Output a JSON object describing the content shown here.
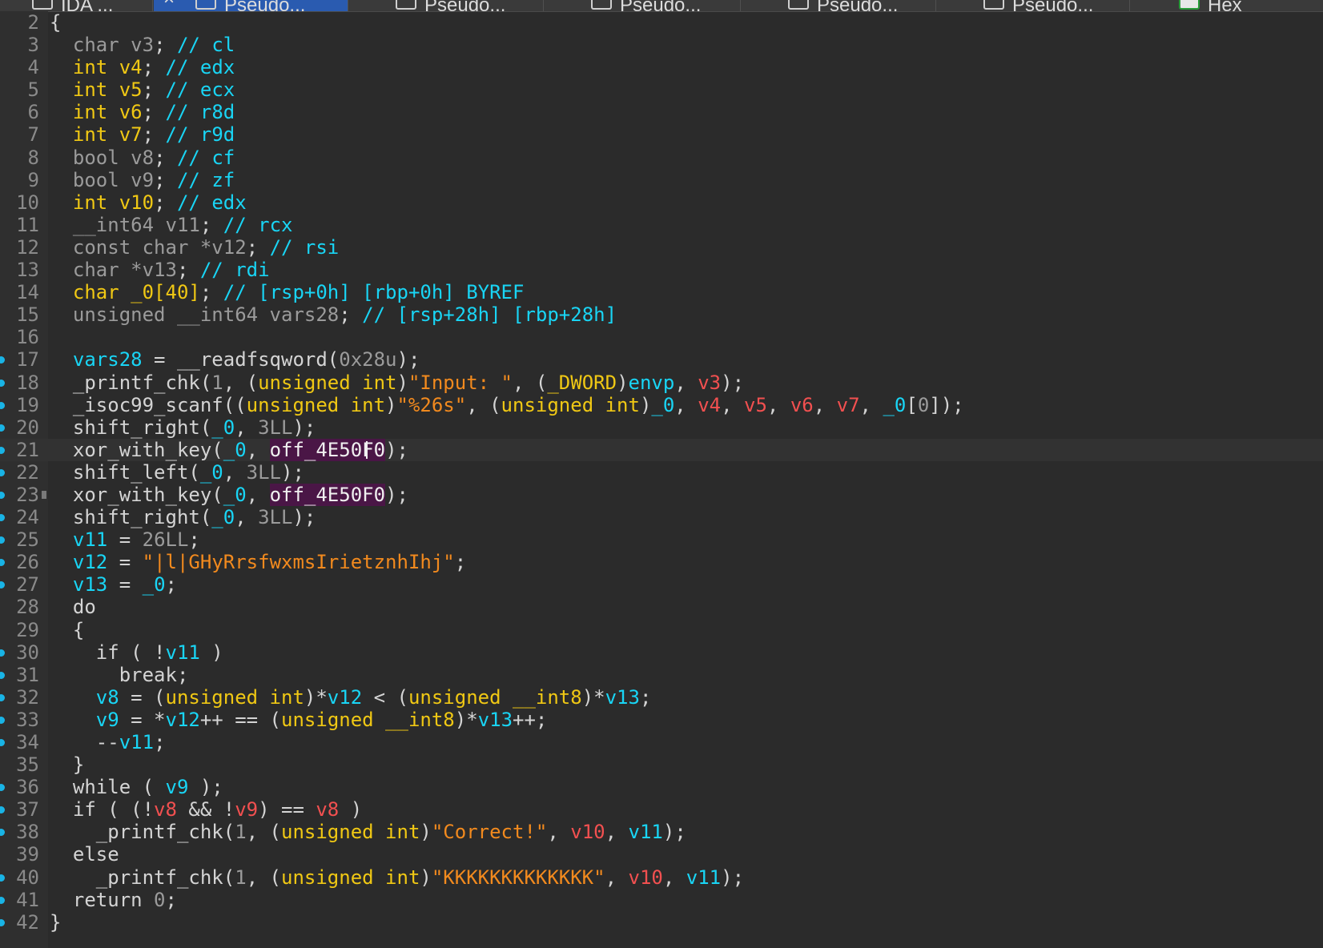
{
  "tabs": [
    {
      "label": "IDA ...",
      "icon": "ida-view-icon"
    },
    {
      "label": "Pseudo...",
      "icon": "pseudocode-icon",
      "active": true,
      "close_glyph": "×"
    },
    {
      "label": "Pseudo...",
      "icon": "pseudocode-icon"
    },
    {
      "label": "Pseudo...",
      "icon": "pseudocode-icon"
    },
    {
      "label": "Pseudo...",
      "icon": "pseudocode-icon"
    },
    {
      "label": "Pseudo...",
      "icon": "pseudocode-icon"
    },
    {
      "label": "Hex",
      "icon": "hex-view-icon"
    }
  ],
  "code_lines": [
    {
      "n": "2",
      "bp": false,
      "segs": [
        [
          "pl",
          "{"
        ]
      ]
    },
    {
      "n": "3",
      "bp": false,
      "segs": [
        [
          "pl",
          "  "
        ],
        [
          "g",
          "char v3"
        ],
        [
          "pl",
          "; "
        ],
        [
          "c",
          "// cl"
        ]
      ]
    },
    {
      "n": "4",
      "bp": false,
      "segs": [
        [
          "pl",
          "  "
        ],
        [
          "k",
          "int v4"
        ],
        [
          "pl",
          "; "
        ],
        [
          "c",
          "// edx"
        ]
      ]
    },
    {
      "n": "5",
      "bp": false,
      "segs": [
        [
          "pl",
          "  "
        ],
        [
          "k",
          "int v5"
        ],
        [
          "pl",
          "; "
        ],
        [
          "c",
          "// ecx"
        ]
      ]
    },
    {
      "n": "6",
      "bp": false,
      "segs": [
        [
          "pl",
          "  "
        ],
        [
          "k",
          "int v6"
        ],
        [
          "pl",
          "; "
        ],
        [
          "c",
          "// r8d"
        ]
      ]
    },
    {
      "n": "7",
      "bp": false,
      "segs": [
        [
          "pl",
          "  "
        ],
        [
          "k",
          "int v7"
        ],
        [
          "pl",
          "; "
        ],
        [
          "c",
          "// r9d"
        ]
      ]
    },
    {
      "n": "8",
      "bp": false,
      "segs": [
        [
          "pl",
          "  "
        ],
        [
          "g",
          "bool v8"
        ],
        [
          "pl",
          "; "
        ],
        [
          "c",
          "// cf"
        ]
      ]
    },
    {
      "n": "9",
      "bp": false,
      "segs": [
        [
          "pl",
          "  "
        ],
        [
          "g",
          "bool v9"
        ],
        [
          "pl",
          "; "
        ],
        [
          "c",
          "// zf"
        ]
      ]
    },
    {
      "n": "10",
      "bp": false,
      "segs": [
        [
          "pl",
          "  "
        ],
        [
          "k",
          "int v10"
        ],
        [
          "pl",
          "; "
        ],
        [
          "c",
          "// edx"
        ]
      ]
    },
    {
      "n": "11",
      "bp": false,
      "segs": [
        [
          "pl",
          "  "
        ],
        [
          "g",
          "__int64 v11"
        ],
        [
          "pl",
          "; "
        ],
        [
          "c",
          "// rcx"
        ]
      ]
    },
    {
      "n": "12",
      "bp": false,
      "segs": [
        [
          "pl",
          "  "
        ],
        [
          "g",
          "const char *v12"
        ],
        [
          "pl",
          "; "
        ],
        [
          "c",
          "// rsi"
        ]
      ]
    },
    {
      "n": "13",
      "bp": false,
      "segs": [
        [
          "pl",
          "  "
        ],
        [
          "g",
          "char *v13"
        ],
        [
          "pl",
          "; "
        ],
        [
          "c",
          "// rdi"
        ]
      ]
    },
    {
      "n": "14",
      "bp": false,
      "segs": [
        [
          "pl",
          "  "
        ],
        [
          "k",
          "char _0[40]"
        ],
        [
          "pl",
          "; "
        ],
        [
          "c",
          "// [rsp+0h] [rbp+0h] BYREF"
        ]
      ]
    },
    {
      "n": "15",
      "bp": false,
      "segs": [
        [
          "pl",
          "  "
        ],
        [
          "g",
          "unsigned __int64 vars28"
        ],
        [
          "pl",
          "; "
        ],
        [
          "c",
          "// [rsp+28h] [rbp+28h]"
        ]
      ]
    },
    {
      "n": "16",
      "bp": false,
      "segs": []
    },
    {
      "n": "17",
      "bp": true,
      "segs": [
        [
          "pl",
          "  "
        ],
        [
          "v",
          "vars28"
        ],
        [
          "pl",
          " = __readfsqword("
        ],
        [
          "g",
          "0x28u"
        ],
        [
          "pl",
          ");"
        ]
      ]
    },
    {
      "n": "18",
      "bp": true,
      "segs": [
        [
          "pl",
          "  _printf_chk("
        ],
        [
          "g",
          "1"
        ],
        [
          "pl",
          ", ("
        ],
        [
          "k",
          "unsigned int"
        ],
        [
          "pl",
          ")"
        ],
        [
          "s",
          "\"Input: \""
        ],
        [
          "pl",
          ", ("
        ],
        [
          "k",
          "_DWORD"
        ],
        [
          "pl",
          ")"
        ],
        [
          "v",
          "envp"
        ],
        [
          "pl",
          ", "
        ],
        [
          "r",
          "v3"
        ],
        [
          "pl",
          ");"
        ]
      ]
    },
    {
      "n": "19",
      "bp": true,
      "segs": [
        [
          "pl",
          "  _isoc99_scanf(("
        ],
        [
          "k",
          "unsigned int"
        ],
        [
          "pl",
          ")"
        ],
        [
          "s",
          "\"%26s\""
        ],
        [
          "pl",
          ", ("
        ],
        [
          "k",
          "unsigned int"
        ],
        [
          "pl",
          ")"
        ],
        [
          "v",
          "_0"
        ],
        [
          "pl",
          ", "
        ],
        [
          "r",
          "v4"
        ],
        [
          "pl",
          ", "
        ],
        [
          "r",
          "v5"
        ],
        [
          "pl",
          ", "
        ],
        [
          "r",
          "v6"
        ],
        [
          "pl",
          ", "
        ],
        [
          "r",
          "v7"
        ],
        [
          "pl",
          ", "
        ],
        [
          "v",
          "_0"
        ],
        [
          "pl",
          "["
        ],
        [
          "g",
          "0"
        ],
        [
          "pl",
          "]);"
        ]
      ]
    },
    {
      "n": "20",
      "bp": true,
      "segs": [
        [
          "pl",
          "  shift_right("
        ],
        [
          "v",
          "_0"
        ],
        [
          "pl",
          ", "
        ],
        [
          "g",
          "3LL"
        ],
        [
          "pl",
          ");"
        ]
      ]
    },
    {
      "n": "21",
      "bp": true,
      "cur": true,
      "segs": [
        [
          "pl",
          "  xor_with_key("
        ],
        [
          "v",
          "_0"
        ],
        [
          "pl",
          ", "
        ],
        [
          "hl",
          "off_4E50F0"
        ],
        [
          "pl",
          ");"
        ]
      ]
    },
    {
      "n": "22",
      "bp": true,
      "segs": [
        [
          "pl",
          "  shift_left("
        ],
        [
          "v",
          "_0"
        ],
        [
          "pl",
          ", "
        ],
        [
          "g",
          "3LL"
        ],
        [
          "pl",
          ");"
        ]
      ]
    },
    {
      "n": "23",
      "bp": true,
      "mark": true,
      "segs": [
        [
          "pl",
          "  xor_with_key("
        ],
        [
          "v",
          "_0"
        ],
        [
          "pl",
          ", "
        ],
        [
          "hl",
          "off_4E50F0"
        ],
        [
          "pl",
          ");"
        ]
      ]
    },
    {
      "n": "24",
      "bp": true,
      "segs": [
        [
          "pl",
          "  shift_right("
        ],
        [
          "v",
          "_0"
        ],
        [
          "pl",
          ", "
        ],
        [
          "g",
          "3LL"
        ],
        [
          "pl",
          ");"
        ]
      ]
    },
    {
      "n": "25",
      "bp": true,
      "segs": [
        [
          "pl",
          "  "
        ],
        [
          "v",
          "v11"
        ],
        [
          "pl",
          " = "
        ],
        [
          "g",
          "26LL"
        ],
        [
          "pl",
          ";"
        ]
      ]
    },
    {
      "n": "26",
      "bp": true,
      "segs": [
        [
          "pl",
          "  "
        ],
        [
          "v",
          "v12"
        ],
        [
          "pl",
          " = "
        ],
        [
          "s",
          "\"|l|GHyRrsfwxmsIrietznhIhj\""
        ],
        [
          "pl",
          ";"
        ]
      ]
    },
    {
      "n": "27",
      "bp": true,
      "segs": [
        [
          "pl",
          "  "
        ],
        [
          "v",
          "v13"
        ],
        [
          "pl",
          " = "
        ],
        [
          "v",
          "_0"
        ],
        [
          "pl",
          ";"
        ]
      ]
    },
    {
      "n": "28",
      "bp": false,
      "segs": [
        [
          "pl",
          "  do"
        ]
      ]
    },
    {
      "n": "29",
      "bp": false,
      "segs": [
        [
          "pl",
          "  {"
        ]
      ]
    },
    {
      "n": "30",
      "bp": true,
      "segs": [
        [
          "pl",
          "    if ( !"
        ],
        [
          "v",
          "v11"
        ],
        [
          "pl",
          " )"
        ]
      ]
    },
    {
      "n": "31",
      "bp": true,
      "segs": [
        [
          "pl",
          "      break;"
        ]
      ]
    },
    {
      "n": "32",
      "bp": true,
      "segs": [
        [
          "pl",
          "    "
        ],
        [
          "v",
          "v8"
        ],
        [
          "pl",
          " = ("
        ],
        [
          "k",
          "unsigned int"
        ],
        [
          "pl",
          ")*"
        ],
        [
          "v",
          "v12"
        ],
        [
          "pl",
          " < ("
        ],
        [
          "k",
          "unsigned __int8"
        ],
        [
          "pl",
          ")*"
        ],
        [
          "v",
          "v13"
        ],
        [
          "pl",
          ";"
        ]
      ]
    },
    {
      "n": "33",
      "bp": true,
      "segs": [
        [
          "pl",
          "    "
        ],
        [
          "v",
          "v9"
        ],
        [
          "pl",
          " = *"
        ],
        [
          "v",
          "v12"
        ],
        [
          "pl",
          "++ == ("
        ],
        [
          "k",
          "unsigned __int8"
        ],
        [
          "pl",
          ")*"
        ],
        [
          "v",
          "v13"
        ],
        [
          "pl",
          "++;"
        ]
      ]
    },
    {
      "n": "34",
      "bp": true,
      "segs": [
        [
          "pl",
          "    --"
        ],
        [
          "v",
          "v11"
        ],
        [
          "pl",
          ";"
        ]
      ]
    },
    {
      "n": "35",
      "bp": false,
      "segs": [
        [
          "pl",
          "  }"
        ]
      ]
    },
    {
      "n": "36",
      "bp": true,
      "segs": [
        [
          "pl",
          "  while ( "
        ],
        [
          "v",
          "v9"
        ],
        [
          "pl",
          " );"
        ]
      ]
    },
    {
      "n": "37",
      "bp": true,
      "segs": [
        [
          "pl",
          "  if ( (!"
        ],
        [
          "r",
          "v8"
        ],
        [
          "pl",
          " && !"
        ],
        [
          "r",
          "v9"
        ],
        [
          "pl",
          ") == "
        ],
        [
          "r",
          "v8"
        ],
        [
          "pl",
          " )"
        ]
      ]
    },
    {
      "n": "38",
      "bp": true,
      "segs": [
        [
          "pl",
          "    _printf_chk("
        ],
        [
          "g",
          "1"
        ],
        [
          "pl",
          ", ("
        ],
        [
          "k",
          "unsigned int"
        ],
        [
          "pl",
          ")"
        ],
        [
          "s",
          "\"Correct!\""
        ],
        [
          "pl",
          ", "
        ],
        [
          "r",
          "v10"
        ],
        [
          "pl",
          ", "
        ],
        [
          "v",
          "v11"
        ],
        [
          "pl",
          ");"
        ]
      ]
    },
    {
      "n": "39",
      "bp": false,
      "segs": [
        [
          "pl",
          "  else"
        ]
      ]
    },
    {
      "n": "40",
      "bp": true,
      "segs": [
        [
          "pl",
          "    _printf_chk("
        ],
        [
          "g",
          "1"
        ],
        [
          "pl",
          ", ("
        ],
        [
          "k",
          "unsigned int"
        ],
        [
          "pl",
          ")"
        ],
        [
          "s",
          "\"KKKKKKKKKKKKK\""
        ],
        [
          "pl",
          ", "
        ],
        [
          "r",
          "v10"
        ],
        [
          "pl",
          ", "
        ],
        [
          "v",
          "v11"
        ],
        [
          "pl",
          ");"
        ]
      ]
    },
    {
      "n": "41",
      "bp": true,
      "segs": [
        [
          "pl",
          "  return "
        ],
        [
          "g",
          "0"
        ],
        [
          "pl",
          ";"
        ]
      ]
    },
    {
      "n": "42",
      "bp": true,
      "segs": [
        [
          "pl",
          "}"
        ]
      ]
    }
  ]
}
